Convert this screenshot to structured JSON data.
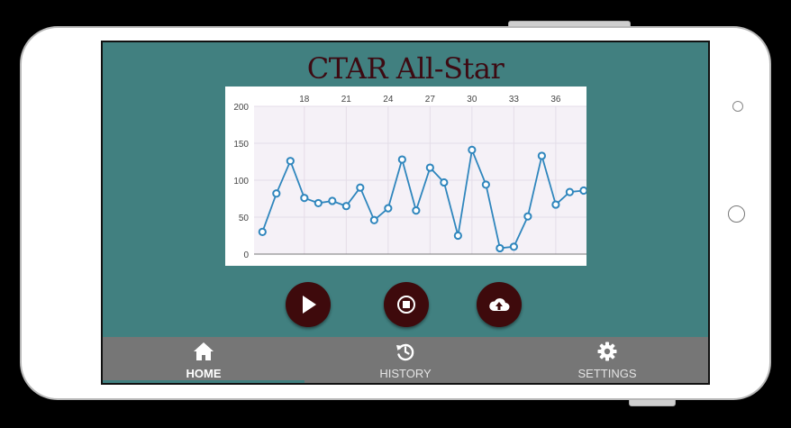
{
  "app": {
    "title": "CTAR All-Star"
  },
  "controls": [
    {
      "name": "play-button",
      "icon": "play-icon"
    },
    {
      "name": "stop-button",
      "icon": "stop-icon"
    },
    {
      "name": "upload-button",
      "icon": "cloud-upload-icon"
    }
  ],
  "nav": {
    "items": [
      {
        "label": "HOME",
        "icon": "home-icon",
        "active": true
      },
      {
        "label": "HISTORY",
        "icon": "history-icon",
        "active": false
      },
      {
        "label": "SETTINGS",
        "icon": "gear-icon",
        "active": false
      }
    ]
  },
  "colors": {
    "screen_bg": "#418080",
    "title": "#3d0a12",
    "button_bg": "#3e0a0c",
    "navbar_bg": "#767676",
    "line": "#2f86bd"
  },
  "chart_data": {
    "type": "line",
    "x": [
      15,
      16,
      17,
      18,
      19,
      20,
      21,
      22,
      23,
      24,
      25,
      26,
      27,
      28,
      29,
      30,
      31,
      32,
      33,
      34,
      35,
      36,
      37,
      38
    ],
    "values": [
      30,
      82,
      126,
      76,
      69,
      72,
      65,
      90,
      46,
      62,
      128,
      59,
      117,
      97,
      25,
      141,
      94,
      8,
      10,
      51,
      133,
      67,
      84,
      86
    ],
    "xticks": [
      18,
      21,
      24,
      27,
      30,
      33,
      36
    ],
    "yticks": [
      0,
      50,
      100,
      150,
      200
    ],
    "ylim": [
      0,
      200
    ],
    "xlim": [
      14.4,
      38.2
    ],
    "grid": true,
    "xaxis_position": "top",
    "title": "",
    "xlabel": "",
    "ylabel": ""
  }
}
